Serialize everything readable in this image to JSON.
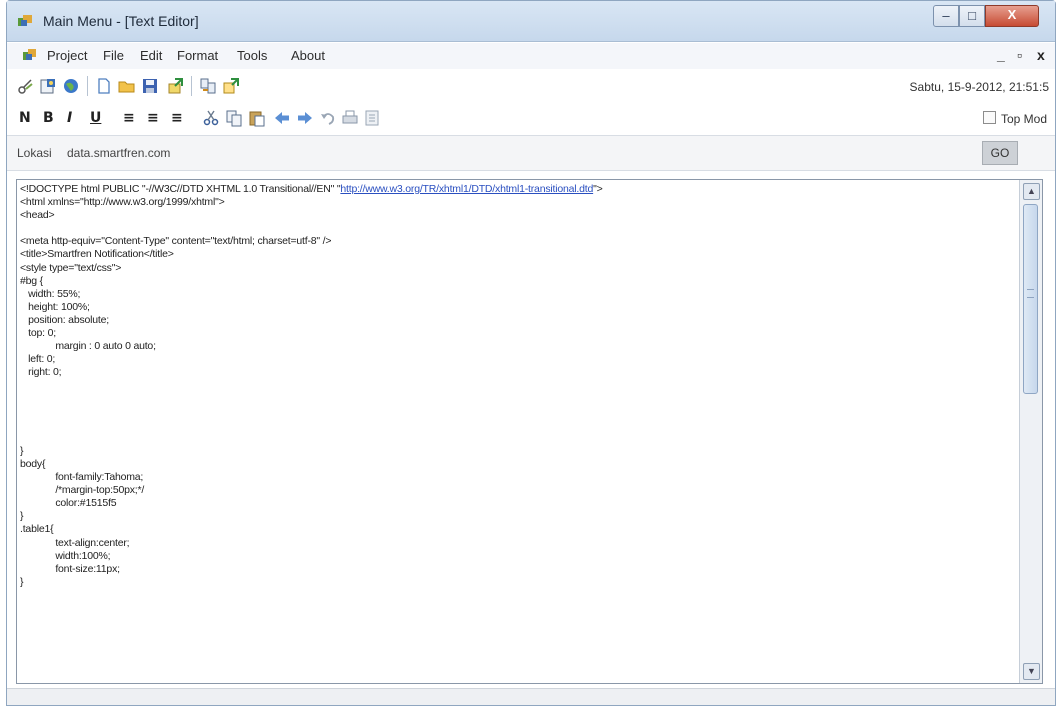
{
  "window": {
    "title": "Main Menu - [Text Editor]",
    "controls": {
      "minimize": "–",
      "maximize": "□",
      "close": "X"
    }
  },
  "menubar": {
    "items": [
      "Project",
      "File",
      "Edit",
      "Format",
      "Tools",
      "About"
    ],
    "mdi_controls": {
      "minimize": "_",
      "restore": "▫",
      "close": "x"
    }
  },
  "toolbar": {
    "icons": [
      "cut-tool-icon",
      "preview-icon",
      "globe-icon",
      "new-file-icon",
      "open-folder-icon",
      "save-icon",
      "export-icon",
      "find-icon",
      "replace-icon"
    ],
    "datetime": "Sabtu, 15-9-2012, 21:51:5"
  },
  "format_bar": {
    "bold": "N",
    "bold2": "B",
    "italic": "I",
    "underline": "U",
    "align_left": "≡",
    "align_center": "≡",
    "align_right": "≡",
    "topmost_label": "Top Mod"
  },
  "location": {
    "label": "Lokasi",
    "value": "data.smartfren.com",
    "go_label": "GO"
  },
  "editor": {
    "line_pre": "<!DOCTYPE html PUBLIC \"-//W3C//DTD XHTML 1.0 Transitional//EN\" \"",
    "line_link": "http://www.w3.org/TR/xhtml1/DTD/xhtml1-transitional.dtd",
    "line_post": "\">",
    "content": "<html xmlns=\"http://www.w3.org/1999/xhtml\">\n<head>\n\n<meta http-equiv=\"Content-Type\" content=\"text/html; charset=utf-8\" />\n<title>Smartfren Notification</title>\n<style type=\"text/css\">\n#bg {\n   width: 55%;\n   height: 100%;\n   position: absolute;\n   top: 0;\n             margin : 0 auto 0 auto;\n   left: 0;\n   right: 0;\n\n\n\n\n\n}\nbody{\n             font-family:Tahoma;\n             /*margin-top:50px;*/\n             color:#1515f5\n}\n.table1{\n             text-align:center;\n             width:100%;\n             font-size:11px;\n}"
  },
  "colors": {
    "titlebar": "#c6d8ec",
    "close_button": "#c74b33",
    "link": "#2a4fc0"
  }
}
